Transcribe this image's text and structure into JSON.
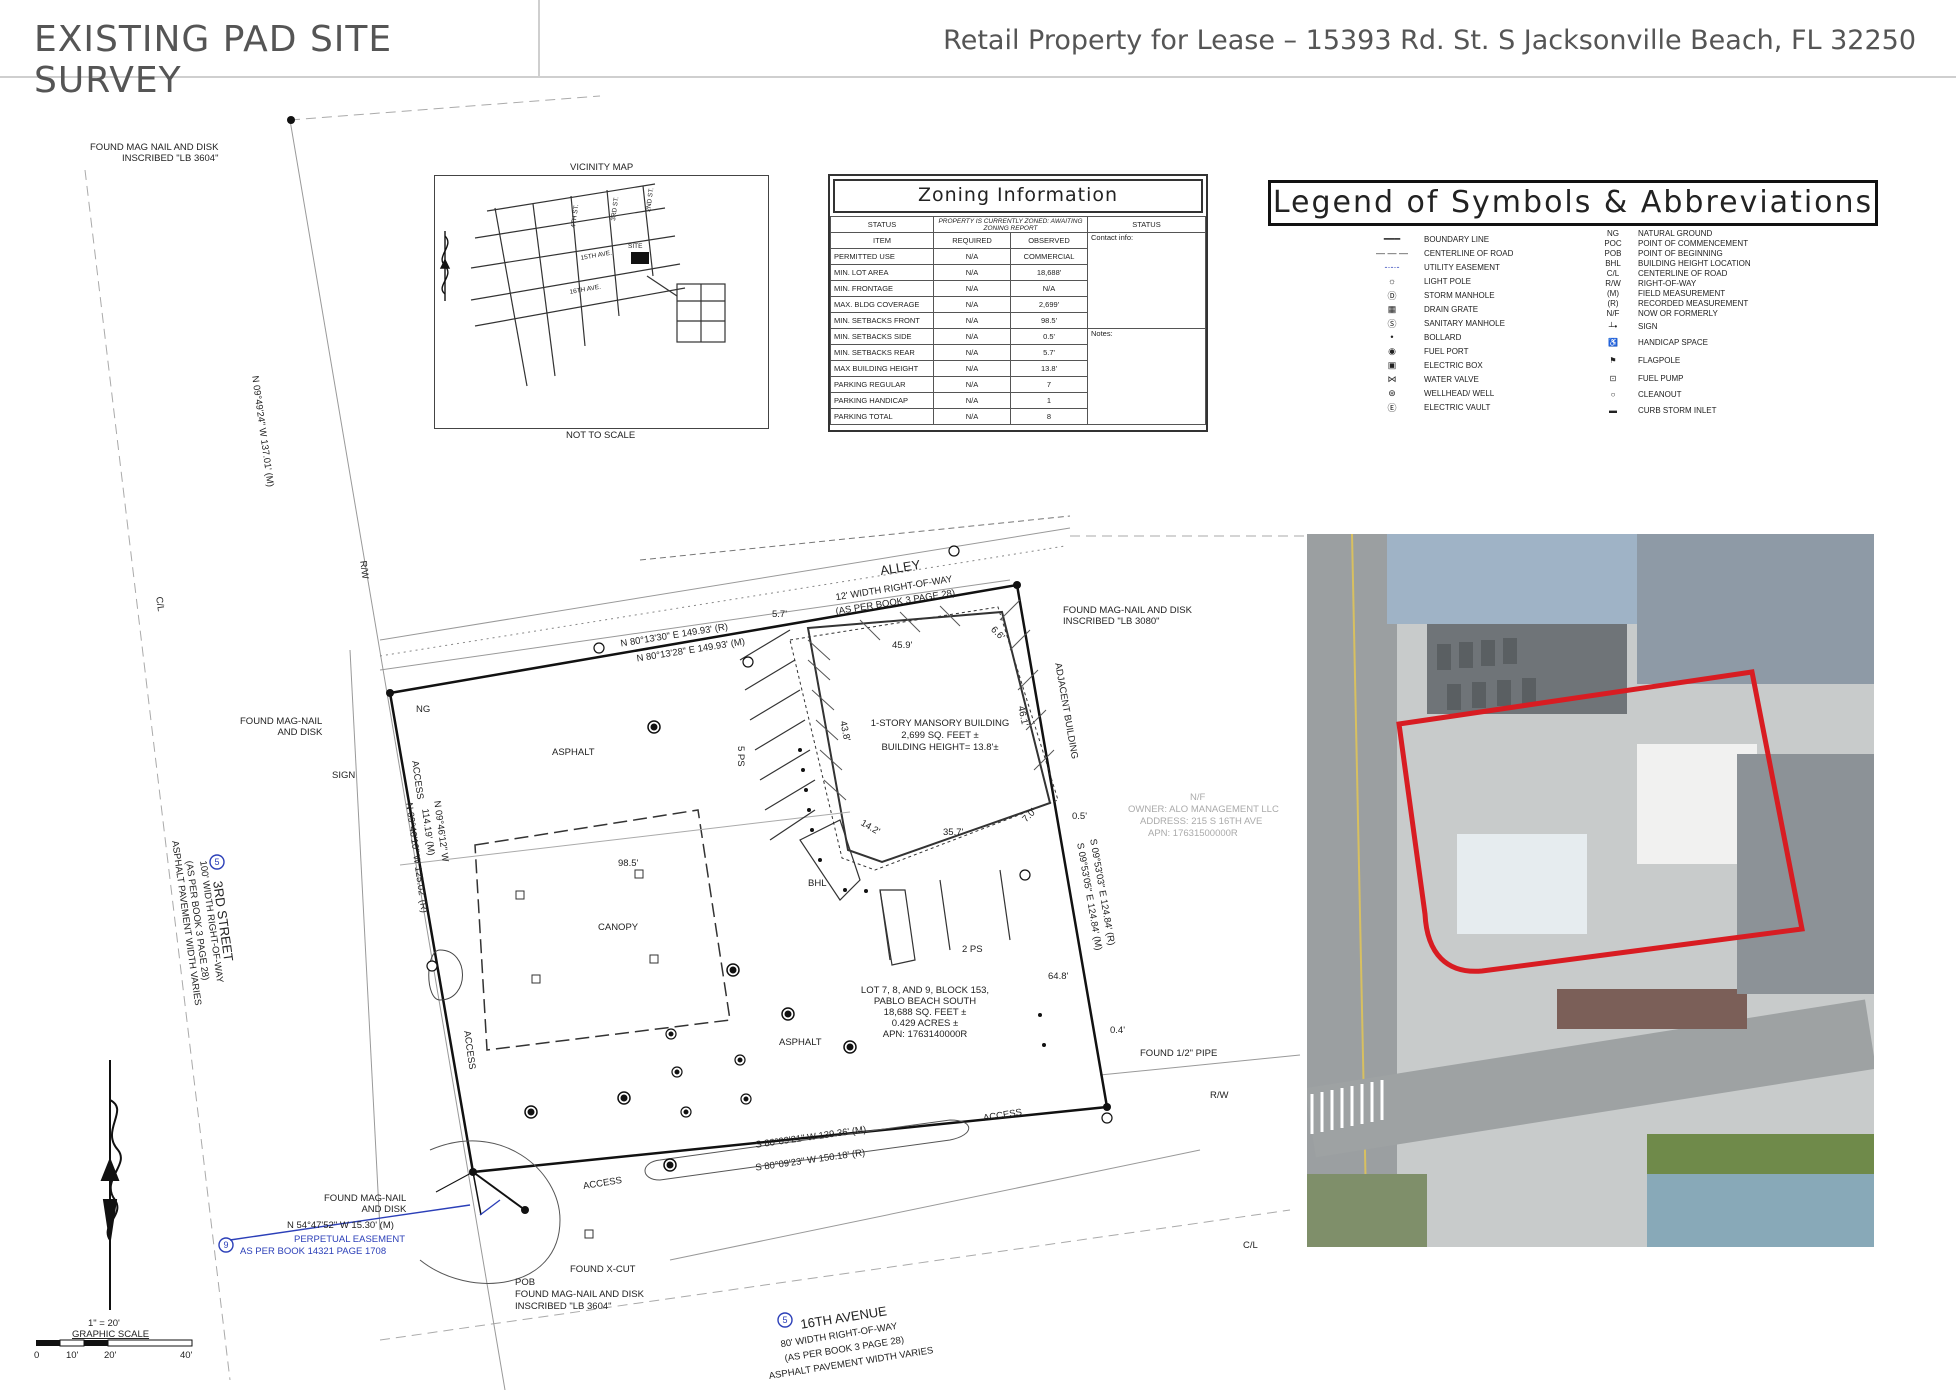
{
  "header": {
    "title": "EXISTING PAD SITE SURVEY",
    "subtitle": "Retail Property for Lease – 15393 Rd. St. S Jacksonville Beach, FL 32250"
  },
  "vicinity_map": {
    "title": "VICINITY MAP",
    "note": "NOT TO SCALE",
    "site_label": "SITE",
    "streets": [
      "4TH ST.",
      "3RD ST.",
      "2ND ST.",
      "15TH AVE.",
      "16TH AVE."
    ]
  },
  "zoning": {
    "title": "Zoning Information",
    "status_label": "STATUS",
    "status_value": "PROPERTY IS CURRENTLY ZONED: AWAITING ZONING REPORT",
    "status_col": "STATUS",
    "headers": [
      "ITEM",
      "REQUIRED",
      "OBSERVED"
    ],
    "contact": "Contact info:",
    "notes": "Notes:",
    "rows": [
      [
        "PERMITTED USE",
        "N/A",
        "COMMERCIAL"
      ],
      [
        "MIN. LOT AREA",
        "N/A",
        "18,688'"
      ],
      [
        "MIN. FRONTAGE",
        "N/A",
        "N/A"
      ],
      [
        "MAX. BLDG COVERAGE",
        "N/A",
        "2,699'"
      ],
      [
        "MIN. SETBACKS FRONT",
        "N/A",
        "98.5'"
      ],
      [
        "MIN. SETBACKS SIDE",
        "N/A",
        "0.5'"
      ],
      [
        "MIN. SETBACKS REAR",
        "N/A",
        "5.7'"
      ],
      [
        "MAX BUILDING HEIGHT",
        "N/A",
        "13.8'"
      ],
      [
        "PARKING REGULAR",
        "N/A",
        "7"
      ],
      [
        "PARKING HANDICAP",
        "N/A",
        "1"
      ],
      [
        "PARKING TOTAL",
        "N/A",
        "8"
      ]
    ]
  },
  "legend": {
    "title": "Legend of Symbols & Abbreviations",
    "symbols": [
      "BOUNDARY LINE",
      "CENTERLINE OF ROAD",
      "UTILITY EASEMENT",
      "LIGHT POLE",
      "STORM MANHOLE",
      "DRAIN GRATE",
      "SANITARY MANHOLE",
      "BOLLARD",
      "FUEL PORT",
      "ELECTRIC BOX",
      "WATER VALVE",
      "WELLHEAD/ WELL",
      "ELECTRIC VAULT"
    ],
    "abbreviations": [
      [
        "NG",
        "NATURAL GROUND"
      ],
      [
        "POC",
        "POINT OF COMMENCEMENT"
      ],
      [
        "POB",
        "POINT OF BEGINNING"
      ],
      [
        "BHL",
        "BUILDING HEIGHT LOCATION"
      ],
      [
        "C/L",
        "CENTERLINE OF ROAD"
      ],
      [
        "R/W",
        "RIGHT-OF-WAY"
      ],
      [
        "(M)",
        "FIELD MEASUREMENT"
      ],
      [
        "(R)",
        "RECORDED MEASUREMENT"
      ],
      [
        "N/F",
        "NOW OR FORMERLY"
      ],
      [
        "",
        "SIGN"
      ],
      [
        "",
        "HANDICAP SPACE"
      ],
      [
        "",
        "FLAGPOLE"
      ],
      [
        "",
        "FUEL PUMP"
      ],
      [
        "",
        "CLEANOUT"
      ],
      [
        "",
        "CURB STORM INLET"
      ]
    ]
  },
  "survey": {
    "found_top_left": "FOUND MAG NAIL AND DISK\nINSCRIBED \"LB 3604\"",
    "brg_left_long": "N 09°49'24\" W 137.01' (M)",
    "cl": "C/L",
    "rw": "R/W",
    "alley": "ALLEY",
    "alley_row1": "12' WIDTH RIGHT-OF-WAY",
    "alley_row2": "(AS PER BOOK 3 PAGE 28)",
    "brg_top_r": "N 80°13'30\" E 149.93' (R)",
    "brg_top_m": "N 80°13'28\" E 149.93' (M)",
    "dim_57": "5.7'",
    "found_ne": "FOUND MAG-NAIL AND DISK\nINSCRIBED \"LB 3080\"",
    "adjacent_building": "ADJACENT BUILDING",
    "found_nw": "FOUND MAG-NAIL\nAND DISK",
    "ng": "NG",
    "sign": "SIGN",
    "access": "ACCESS",
    "asphalt": "ASPHALT",
    "ps5": "5 PS",
    "ps2": "2 PS",
    "building_1": "1-STORY MANSORY BUILDING",
    "building_2": "2,699 SQ. FEET ±",
    "building_3": "BUILDING HEIGHT= 13.8'±",
    "dim_459": "45.9'",
    "dim_66": "6.6'",
    "dim_438": "43.8'",
    "dim_461": "46.1'",
    "dim_142": "14.2'",
    "dim_357": "35.7'",
    "dim_70": "7.0'",
    "dim_05": "0.5'",
    "dim_985": "98.5'",
    "dim_648": "64.8'",
    "dim_04": "0.4'",
    "canopy": "CANOPY",
    "bhl": "BHL",
    "brg_left_1": "N 09°46'12\" W",
    "brg_left_2": "114.19' (M)",
    "brg_left_3": "N 09°46'10\" W 125.02' (R)",
    "brg_right_1": "S 09°53'03\" E 124.84' (R)",
    "brg_right_2": "S 09°53'05\" E 124.84' (M)",
    "nf_1": "N/F",
    "nf_2": "OWNER: ALO MANAGEMENT LLC",
    "nf_3": "ADDRESS: 215 S 16TH AVE",
    "nf_4": "APN: 17631500000R",
    "lot_1": "LOT 7, 8, AND 9, BLOCK 153,",
    "lot_2": "PABLO BEACH SOUTH",
    "lot_3": "18,688 SQ. FEET ±",
    "lot_4": "0.429 ACRES ±",
    "lot_5": "APN: 1763140000R",
    "found_pipe": "FOUND 1/2\" PIPE",
    "brg_bot_m": "S 80°09'21\" W 139.36' (M)",
    "brg_bot_r": "S 80°09'23\" W 150.18' (R)",
    "third_st_1": "3RD STREET",
    "third_st_2": "100' WIDTH RIGHT-OF-WAY",
    "third_st_3": "(AS PER BOOK 3 PAGE 28)",
    "third_st_4": "ASPHALT PAVEMENT WIDTH VARIES",
    "found_sw": "FOUND MAG-NAIL\nAND DISK",
    "brg_sw": "N 54°47'52\" W 15.30' (M)",
    "easement_1": "PERPETUAL EASEMENT",
    "easement_2": "AS PER BOOK 14321 PAGE 1708",
    "found_xcut": "FOUND X-CUT",
    "pob": "POB",
    "pob_2": "FOUND MAG-NAIL AND DISK",
    "pob_3": "INSCRIBED \"LB 3604\"",
    "ave_1": "16TH AVENUE",
    "ave_2": "80' WIDTH RIGHT-OF-WAY",
    "ave_3": "(AS PER BOOK 3 PAGE 28)",
    "ave_4": "ASPHALT PAVEMENT WIDTH VARIES",
    "scale_1": "1\" = 20'",
    "scale_2": "GRAPHIC SCALE",
    "scale_ticks": [
      "0",
      "10'",
      "20'",
      "40'"
    ],
    "circle_5": "5",
    "circle_9": "9"
  },
  "colors": {
    "site_outline": "#d81c22",
    "easement_blue": "#2b3fb8",
    "header_text": "#555555"
  }
}
